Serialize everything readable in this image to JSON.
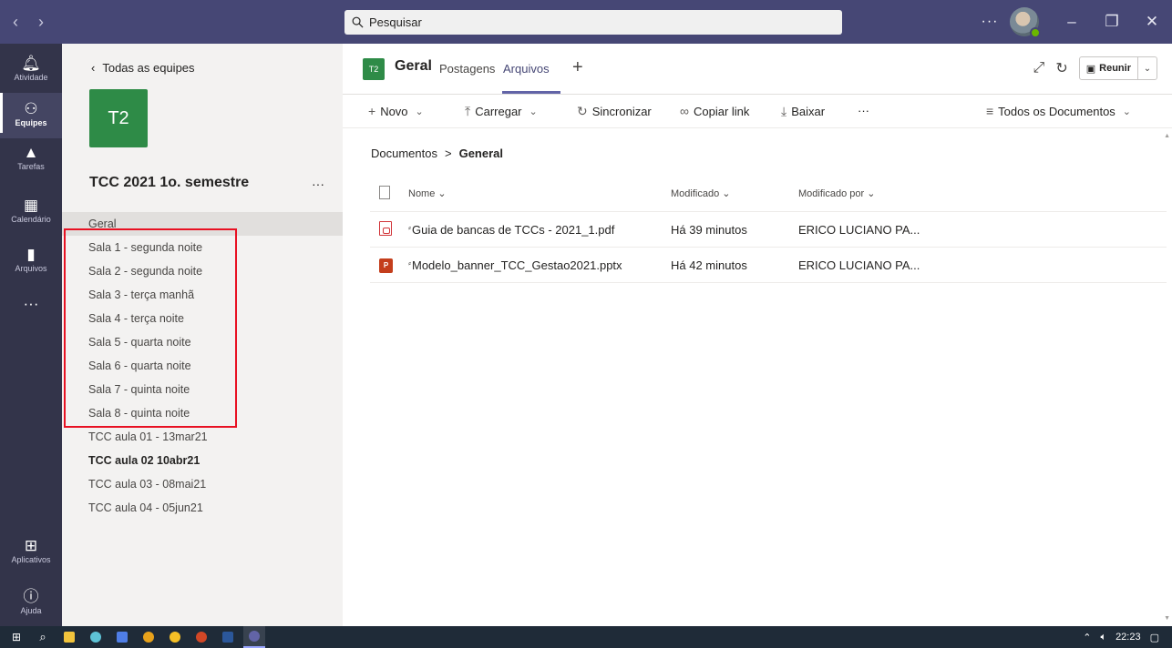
{
  "titlebar": {
    "back_icon": "chevron-left-icon",
    "forward_icon": "chevron-right-icon",
    "search_placeholder": "Pesquisar",
    "more": "···",
    "window_controls": [
      "minimize-icon",
      "restore-icon",
      "close-icon"
    ],
    "bg_color": "#464775"
  },
  "rail": {
    "items": [
      {
        "label": "Atividade",
        "icon": "bell-icon"
      },
      {
        "label": "Equipes",
        "icon": "teams-icon",
        "active": true
      },
      {
        "label": "Tarefas",
        "icon": "tasks-icon"
      },
      {
        "label": "Calendário",
        "icon": "calendar-icon"
      },
      {
        "label": "Arquivos",
        "icon": "file-icon"
      }
    ],
    "more": "···",
    "bottom_items": [
      {
        "label": "Aplicativos",
        "icon": "apps-icon"
      },
      {
        "label": "Ajuda",
        "icon": "help-icon"
      }
    ]
  },
  "teampanel": {
    "back_label": "Todas as equipes",
    "team_avatar": "T2",
    "team_name": "TCC 2021 1o. semestre",
    "more": "···",
    "channels": [
      {
        "label": "Geral",
        "selected": true
      },
      {
        "label": "Sala 1 - segunda noite"
      },
      {
        "label": "Sala 2 - segunda noite"
      },
      {
        "label": "Sala 3 - terça manhã"
      },
      {
        "label": "Sala 4 - terça noite"
      },
      {
        "label": "Sala 5 - quarta noite"
      },
      {
        "label": "Sala 6 - quarta noite"
      },
      {
        "label": "Sala 7 - quinta noite"
      },
      {
        "label": "Sala 8 - quinta noite"
      },
      {
        "label": "TCC aula 01 - 13mar21"
      },
      {
        "label": "TCC aula 02 10abr21",
        "bold": true
      },
      {
        "label": "TCC aula 03 - 08mai21"
      },
      {
        "label": "TCC aula 04 - 05jun21"
      }
    ]
  },
  "header": {
    "channel_avatar": "T2",
    "channel_title": "Geral",
    "tabs": [
      {
        "label": "Postagens"
      },
      {
        "label": "Arquivos",
        "active": true
      }
    ],
    "add_tab": "+",
    "reunir_label": "Reunir"
  },
  "toolbar": {
    "novo": "Novo",
    "carregar": "Carregar",
    "sincronizar": "Sincronizar",
    "copiar_link": "Copiar link",
    "baixar": "Baixar",
    "more": "···",
    "view": "Todos os Documentos"
  },
  "breadcrumb": {
    "root": "Documentos",
    "separator": ">",
    "current": "General"
  },
  "files": {
    "columns": {
      "name": "Nome",
      "modified": "Modificado",
      "modified_by": "Modificado por"
    },
    "rows": [
      {
        "icon": "pdf-icon",
        "name": "Guia de bancas de TCCs - 2021_1.pdf",
        "modified": "Há 39 minutos",
        "modified_by": "ERICO LUCIANO PA..."
      },
      {
        "icon": "pptx-icon",
        "name": "Modelo_banner_TCC_Gestao2021.pptx",
        "modified": "Há 42 minutos",
        "modified_by": "ERICO LUCIANO PA..."
      }
    ]
  },
  "taskbar": {
    "time": "22:23"
  }
}
